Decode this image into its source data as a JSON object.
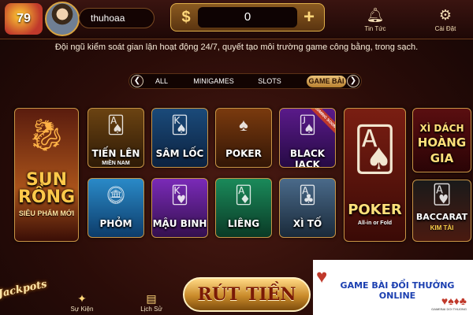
{
  "header": {
    "logo_text": "79",
    "username": "thuhoaa",
    "currency_symbol": "$",
    "balance": "0",
    "add_symbol": "+",
    "news_label": "Tin Tức",
    "settings_label": "Cài Đặt"
  },
  "notice": "Đội ngũ kiểm soát gian lận hoạt động 24/7, quyết tạo môi trường game công bằng, trong sạch.",
  "tabs": {
    "prev_arrow": "❮",
    "next_arrow": "❯",
    "items": [
      "ALL",
      "MINIGAMES",
      "SLOTS",
      "GAME BÀI"
    ],
    "active": "GAME BÀI"
  },
  "games": {
    "sun_rong": {
      "line1": "SUN",
      "line2": "RỒNG",
      "sub": "SIÊU PHẨM MỚI"
    },
    "tien_len": {
      "title": "TIẾN LÊN",
      "sub": "MIỀN NAM"
    },
    "sam_loc": {
      "title": "SÂM LỐC"
    },
    "poker_small": {
      "title": "POKER"
    },
    "black_jack": {
      "title": "BLACK JACK",
      "ribbon": "COMING SOON"
    },
    "phom": {
      "title": "PHỎM"
    },
    "mau_binh": {
      "title": "MẬU BINH"
    },
    "lieng": {
      "title": "LIÊNG"
    },
    "xi_to": {
      "title": "XÌ TỐ"
    },
    "poker_big": {
      "title": "POKER",
      "sub": "All-in or Fold"
    },
    "xi_dach": {
      "line1": "XÌ DÁCH",
      "line2": "HOÀNG",
      "line3": "GIA"
    },
    "baccarat": {
      "title": "BACCARAT",
      "sub": "KIM TÀI"
    }
  },
  "bottom": {
    "jackpot_label": "Jackpots",
    "su_kien_label": "Sự Kiện",
    "lich_su_label": "Lịch Sử",
    "withdraw_label": "RÚT TIỀN"
  },
  "promo": {
    "text": "GAME BÀI ĐỔI THƯỞNG ONLINE",
    "suits": "♥♠♦♣",
    "small_text": "GAMEBAI DOI THUONG"
  },
  "colors": {
    "background": "#2a0c08",
    "gold_accent": "#d9a441",
    "active_tab": "#e9c37a",
    "promo_text": "#1b3fb0"
  }
}
